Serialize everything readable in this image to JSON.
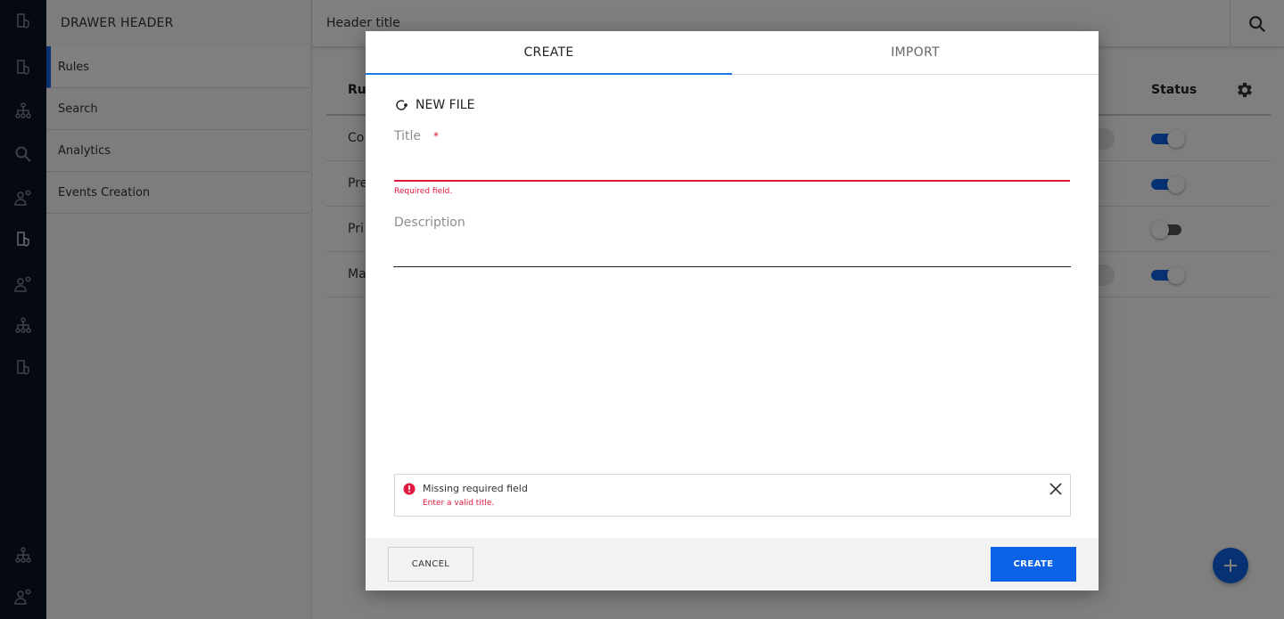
{
  "rail": {
    "icons": [
      "docs-shield-icon",
      "docs-shield-icon",
      "hierarchy-icon",
      "search-icon",
      "user-settings-icon",
      "docs-shield-icon",
      "user-settings-icon",
      "hierarchy-icon",
      "docs-shield-icon",
      "hierarchy-icon",
      "user-settings-icon"
    ]
  },
  "drawer": {
    "header": "DRAWER HEADER",
    "items": [
      {
        "label": "Rules",
        "active": true
      },
      {
        "label": "Search",
        "active": false
      },
      {
        "label": "Analytics",
        "active": false
      },
      {
        "label": "Events Creation",
        "active": false
      }
    ]
  },
  "header": {
    "title": "Header title"
  },
  "table": {
    "columns": {
      "rule": "Ru",
      "status": "Status"
    },
    "rows": [
      {
        "name": "Co",
        "status": "on"
      },
      {
        "name": "Pre",
        "status": "on"
      },
      {
        "name": "Pri",
        "status": "off"
      },
      {
        "name": "Ma",
        "status": "on"
      }
    ]
  },
  "modal": {
    "tabs": [
      {
        "label": "CREATE",
        "active": true
      },
      {
        "label": "IMPORT",
        "active": false
      }
    ],
    "new_file_label": "NEW FILE",
    "title_field": {
      "label": "Title",
      "required_marker": "*",
      "value": "",
      "error": "Required field."
    },
    "description_field": {
      "label": "Description",
      "value": ""
    },
    "alert": {
      "title": "Missing required field",
      "message": "Enter a valid title."
    },
    "cancel_label": "CANCEL",
    "create_label": "CREATE"
  },
  "colors": {
    "primary": "#0c62e6",
    "error": "#e0193e",
    "rail_bg": "#0b1424"
  }
}
